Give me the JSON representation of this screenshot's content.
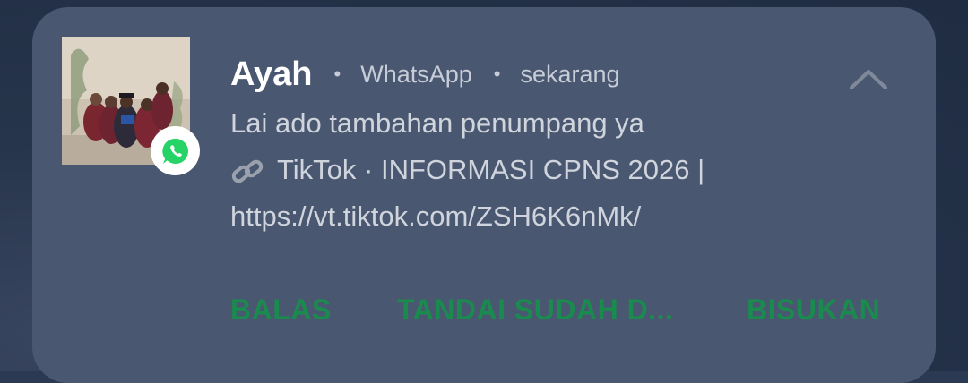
{
  "notification": {
    "sender": "Ayah",
    "app": "WhatsApp",
    "time": "sekarang",
    "separator": "•",
    "message_line1": "Lai ado tambahan penumpang ya",
    "message_line2": "TikTok · INFORMASI CPNS 2026 |",
    "message_line3": "https://vt.tiktok.com/ZSH6K6nMk/",
    "avatar_icon": "contact-photo",
    "badge_icon": "whatsapp-icon",
    "link_icon": "link-icon",
    "collapse_icon": "chevron-up-icon"
  },
  "actions": {
    "reply": "BALAS",
    "mark_read": "TANDAI SUDAH D...",
    "mute": "BISUKAN"
  },
  "colors": {
    "card": "#4a5770",
    "action": "#1b8a4f",
    "whatsapp_green": "#25d366"
  }
}
